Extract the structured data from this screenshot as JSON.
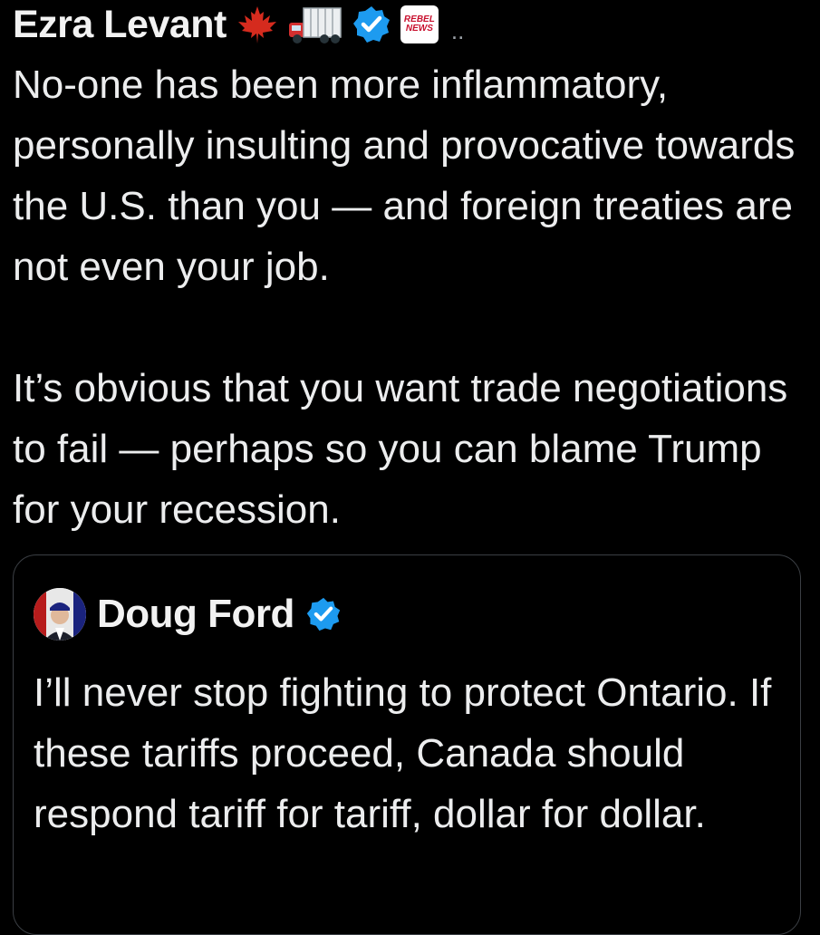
{
  "tweet": {
    "author": {
      "name": "Ezra Levant",
      "badges": [
        "maple-leaf-emoji",
        "truck-emoji",
        "verified-icon"
      ],
      "affiliate_logo": {
        "line1": "REBEL",
        "line2": "NEWS"
      },
      "overflow": ".."
    },
    "paragraphs": [
      "No-one has been more inflammatory, personally insulting and provocative towards the U.S. than you — and foreign treaties are not even your job.",
      "It’s obvious that you want trade negotiations to fail — perhaps so you can blame Trump for your recession."
    ]
  },
  "quoted_tweet": {
    "author": {
      "name": "Doug Ford",
      "badges": [
        "verified-icon"
      ]
    },
    "text": "I’ll never stop fighting to protect Ontario. If these tariffs proceed, Canada should respond tariff for tariff, dollar for dollar."
  },
  "colors": {
    "background": "#000000",
    "text": "#ecedee",
    "verified": "#1d9bf0",
    "card_border": "#3b3f44",
    "maple_leaf": "#d52b1e"
  }
}
